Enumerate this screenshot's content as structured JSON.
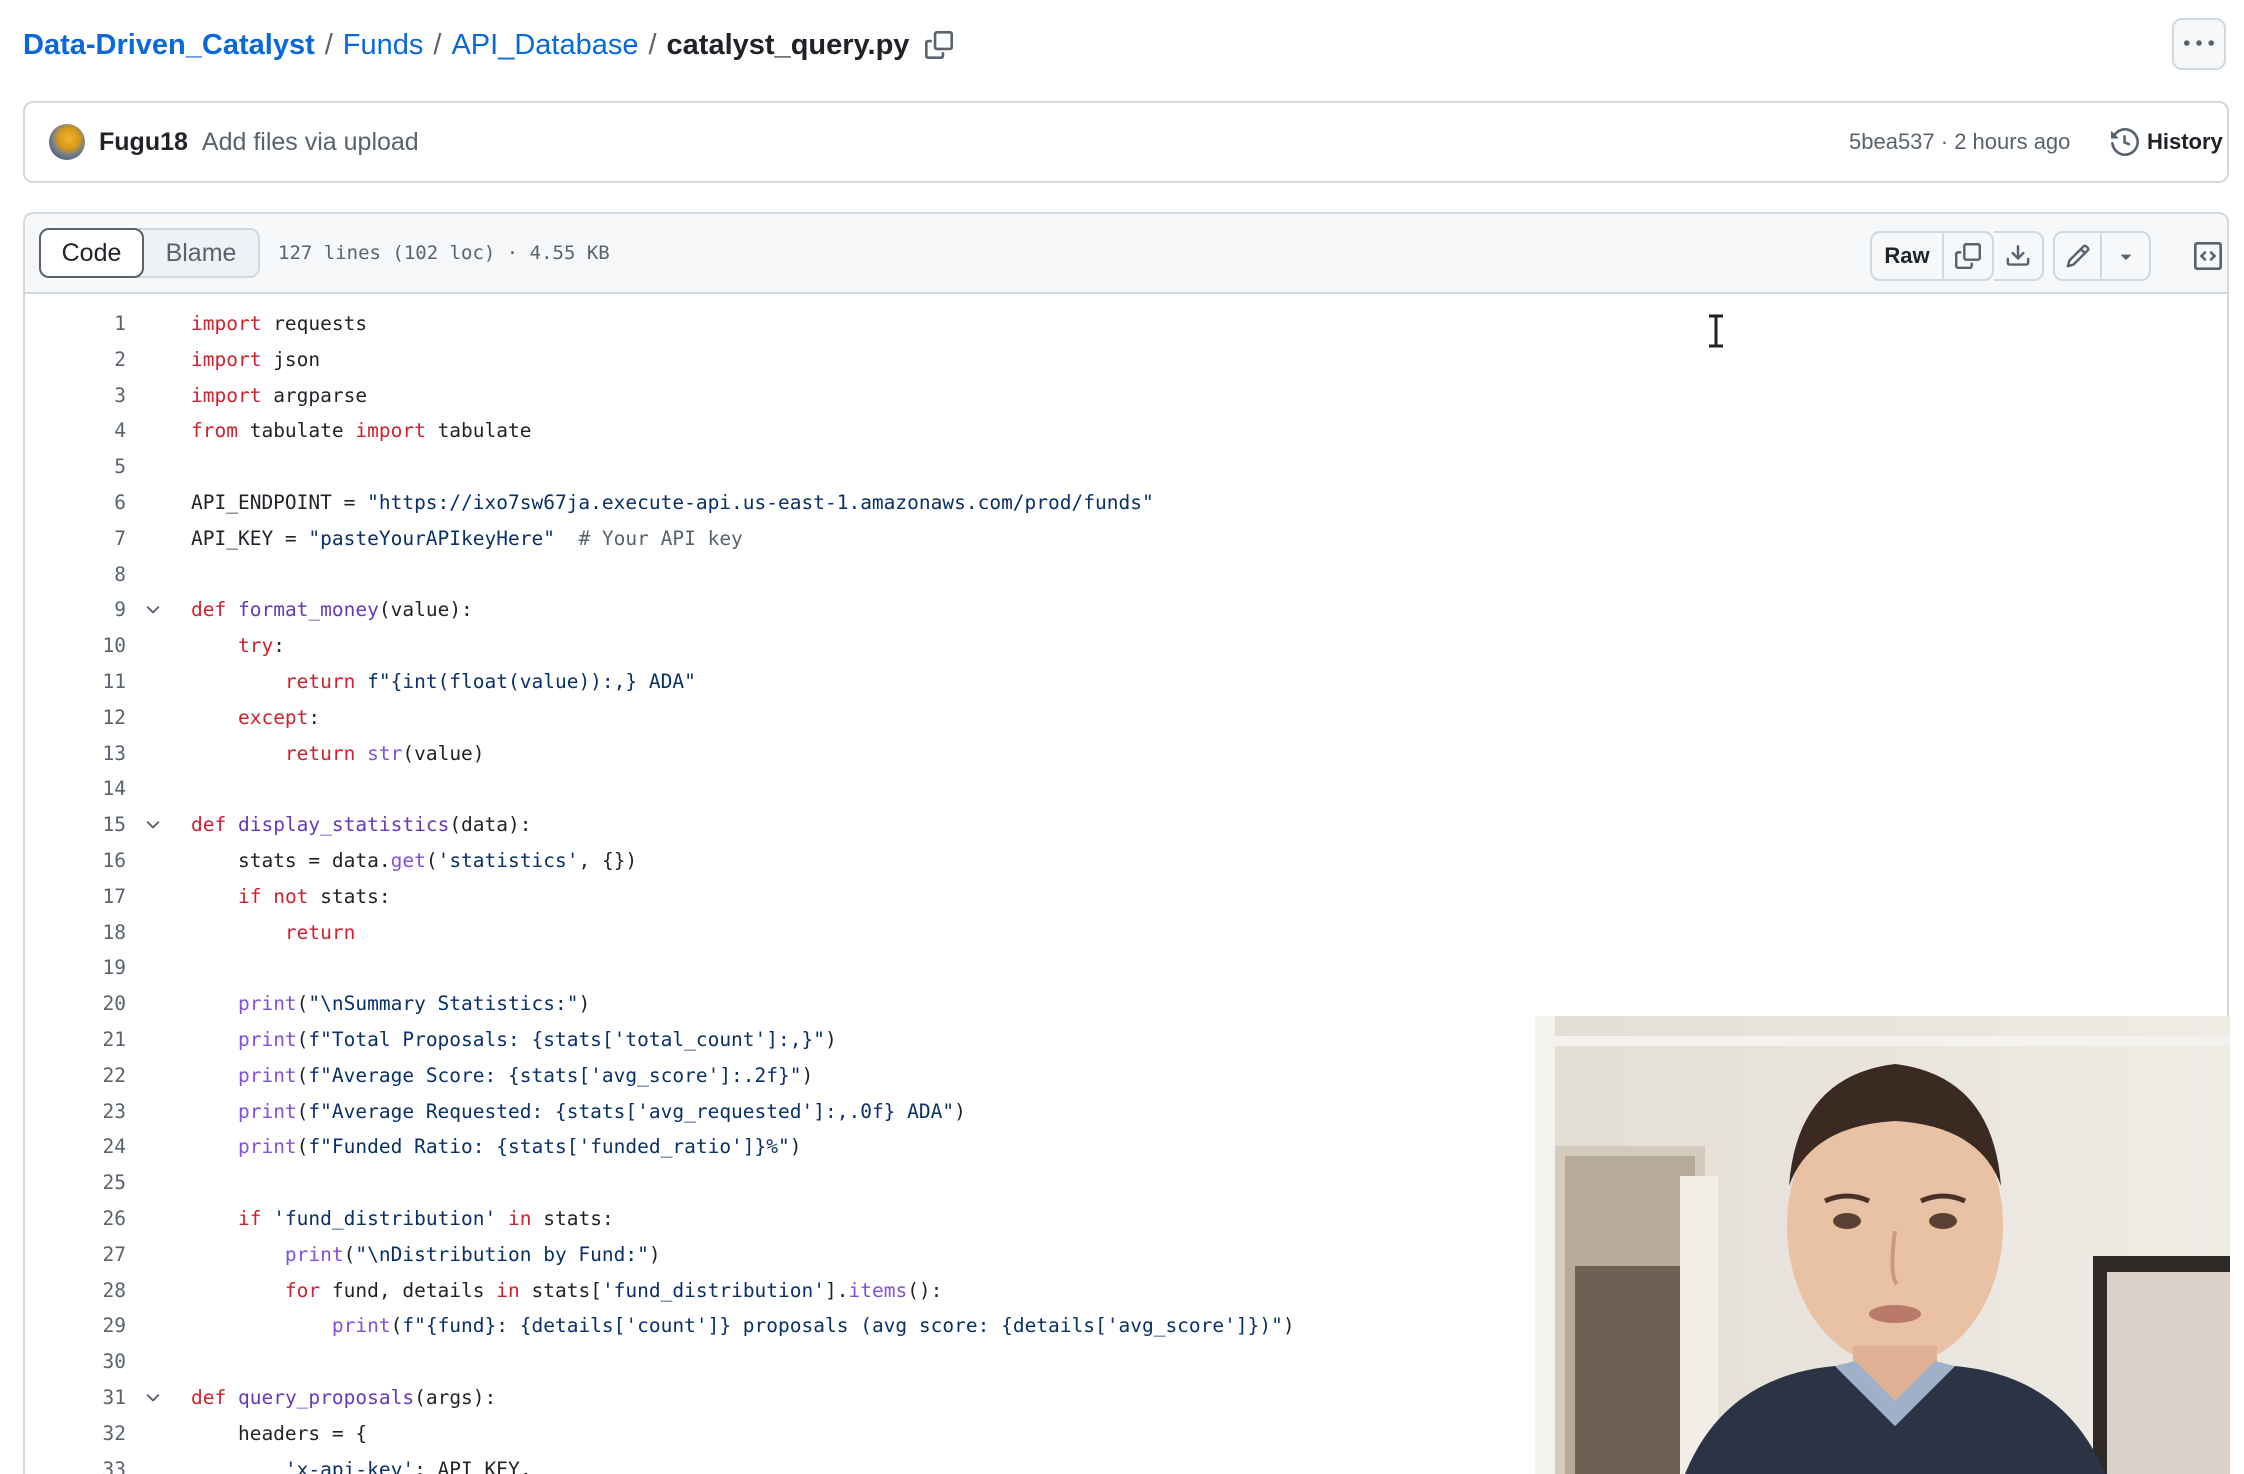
{
  "breadcrumb": {
    "repo": "Data-Driven_Catalyst",
    "folder1": "Funds",
    "folder2": "API_Database",
    "file": "catalyst_query.py",
    "separator": "/"
  },
  "commit": {
    "author": "Fugu18",
    "message": "Add files via upload",
    "meta": "5bea537 · 2 hours ago",
    "history_label": "History"
  },
  "file_header": {
    "tabs": [
      {
        "label": "Code",
        "active": true
      },
      {
        "label": "Blame",
        "active": false
      }
    ],
    "info": "127 lines (102 loc) · 4.55 KB",
    "raw_label": "Raw"
  },
  "icons": {
    "copy_path": "copy-icon",
    "more": "kebab-horizontal-icon",
    "history": "history-icon",
    "copy_raw": "copy-icon",
    "download": "download-icon",
    "edit": "pencil-icon",
    "edit_dropdown": "triangle-down-icon",
    "symbols": "code-square-icon",
    "fold": "chevron-down-icon"
  },
  "colors": {
    "link": "#0969da",
    "keyword": "#cf222e",
    "string": "#0a3069",
    "function": "#6639ba",
    "builtin": "#8250df",
    "comment": "#59636e",
    "border": "#d1d9e0",
    "header_bg": "#f6f8fa"
  },
  "code": {
    "language": "python",
    "lines": [
      {
        "n": "1",
        "fold": false,
        "text": "import requests"
      },
      {
        "n": "2",
        "fold": false,
        "text": "import json"
      },
      {
        "n": "3",
        "fold": false,
        "text": "import argparse"
      },
      {
        "n": "4",
        "fold": false,
        "text": "from tabulate import tabulate"
      },
      {
        "n": "5",
        "fold": false,
        "text": ""
      },
      {
        "n": "6",
        "fold": false,
        "text": "API_ENDPOINT = \"https://ixo7sw67ja.execute-api.us-east-1.amazonaws.com/prod/funds\""
      },
      {
        "n": "7",
        "fold": false,
        "text": "API_KEY = \"pasteYourAPIkeyHere\"  # Your API key"
      },
      {
        "n": "8",
        "fold": false,
        "text": ""
      },
      {
        "n": "9",
        "fold": true,
        "text": "def format_money(value):"
      },
      {
        "n": "10",
        "fold": false,
        "text": "    try:"
      },
      {
        "n": "11",
        "fold": false,
        "text": "        return f\"{int(float(value)):,} ADA\""
      },
      {
        "n": "12",
        "fold": false,
        "text": "    except:"
      },
      {
        "n": "13",
        "fold": false,
        "text": "        return str(value)"
      },
      {
        "n": "14",
        "fold": false,
        "text": ""
      },
      {
        "n": "15",
        "fold": true,
        "text": "def display_statistics(data):"
      },
      {
        "n": "16",
        "fold": false,
        "text": "    stats = data.get('statistics', {})"
      },
      {
        "n": "17",
        "fold": false,
        "text": "    if not stats:"
      },
      {
        "n": "18",
        "fold": false,
        "text": "        return"
      },
      {
        "n": "19",
        "fold": false,
        "text": ""
      },
      {
        "n": "20",
        "fold": false,
        "text": "    print(\"\\nSummary Statistics:\")"
      },
      {
        "n": "21",
        "fold": false,
        "text": "    print(f\"Total Proposals: {stats['total_count']:,}\")"
      },
      {
        "n": "22",
        "fold": false,
        "text": "    print(f\"Average Score: {stats['avg_score']:.2f}\")"
      },
      {
        "n": "23",
        "fold": false,
        "text": "    print(f\"Average Requested: {stats['avg_requested']:,.0f} ADA\")"
      },
      {
        "n": "24",
        "fold": false,
        "text": "    print(f\"Funded Ratio: {stats['funded_ratio']}%\")"
      },
      {
        "n": "25",
        "fold": false,
        "text": ""
      },
      {
        "n": "26",
        "fold": false,
        "text": "    if 'fund_distribution' in stats:"
      },
      {
        "n": "27",
        "fold": false,
        "text": "        print(\"\\nDistribution by Fund:\")"
      },
      {
        "n": "28",
        "fold": false,
        "text": "        for fund, details in stats['fund_distribution'].items():"
      },
      {
        "n": "29",
        "fold": false,
        "text": "            print(f\"{fund}: {details['count']} proposals (avg score: {details['avg_score']})\")"
      },
      {
        "n": "30",
        "fold": false,
        "text": ""
      },
      {
        "n": "31",
        "fold": true,
        "text": "def query_proposals(args):"
      },
      {
        "n": "32",
        "fold": false,
        "text": "    headers = {"
      },
      {
        "n": "33",
        "fold": false,
        "text": "        'x-api-key': API_KEY,"
      }
    ]
  }
}
